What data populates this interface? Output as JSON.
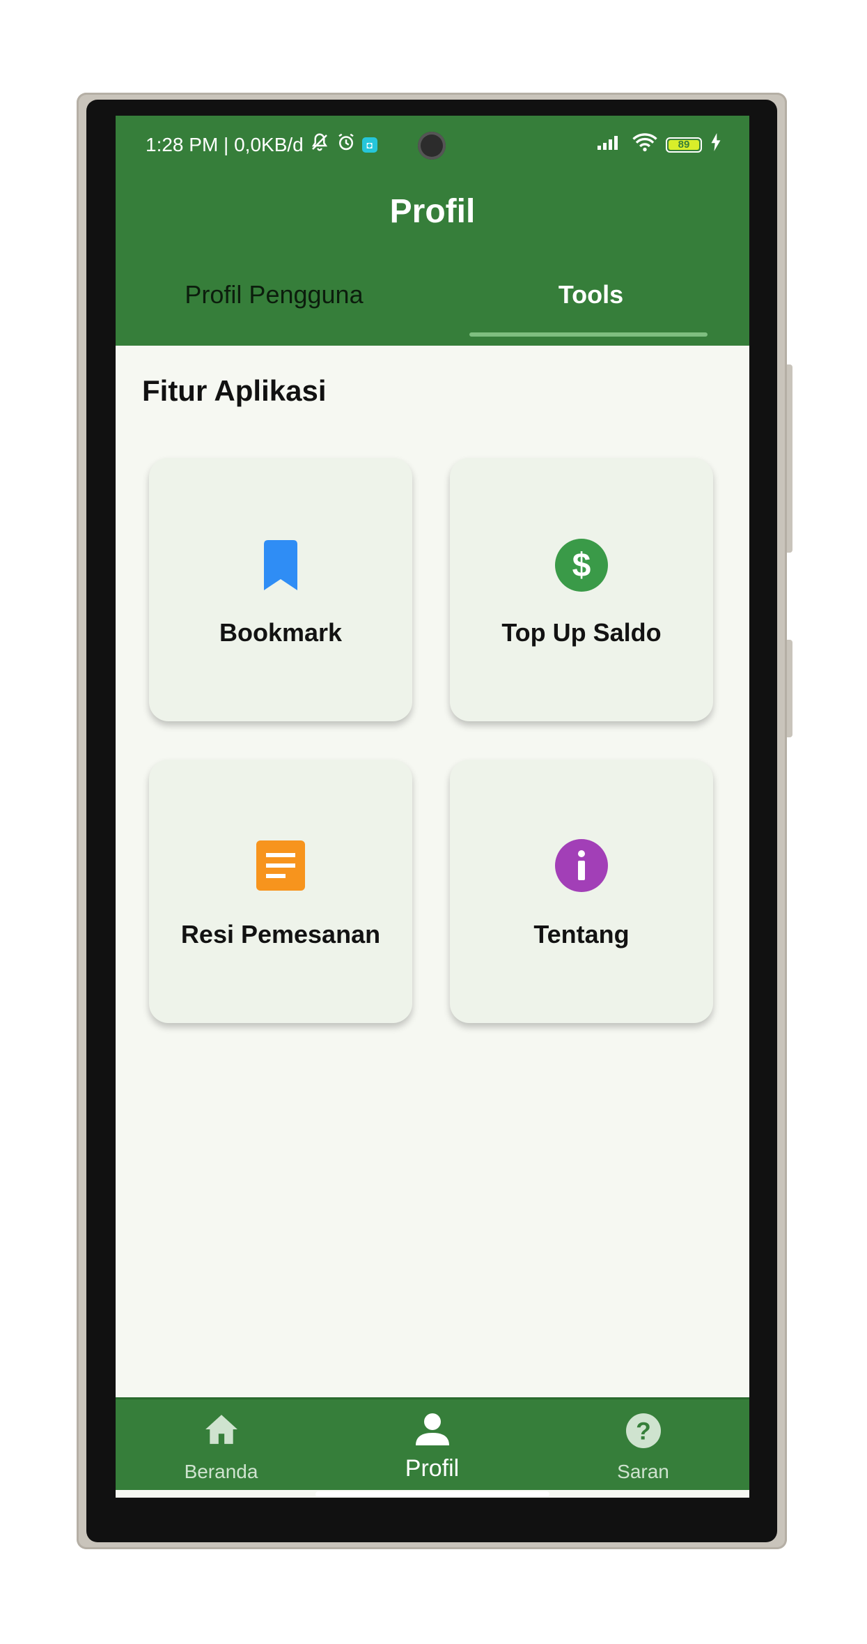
{
  "status_bar": {
    "time_info": "1:28 PM | 0,0KB/d",
    "battery": "89"
  },
  "header": {
    "title": "Profil",
    "tabs": [
      {
        "label": "Profil Pengguna",
        "active": false
      },
      {
        "label": "Tools",
        "active": true
      }
    ]
  },
  "section": {
    "title": "Fitur Aplikasi"
  },
  "features": [
    {
      "label": "Bookmark",
      "icon": "bookmark-icon",
      "color": "#2f8df5"
    },
    {
      "label": "Top Up Saldo",
      "icon": "dollar-icon",
      "color": "#3a9a48"
    },
    {
      "label": "Resi Pemesanan",
      "icon": "receipt-icon",
      "color": "#f7941d"
    },
    {
      "label": "Tentang",
      "icon": "info-icon",
      "color": "#a23fb7"
    }
  ],
  "bottom_nav": [
    {
      "label": "Beranda",
      "icon": "home-icon",
      "active": false
    },
    {
      "label": "Profil",
      "icon": "person-icon",
      "active": true
    },
    {
      "label": "Saran",
      "icon": "help-icon",
      "active": false
    }
  ],
  "colors": {
    "primary": "#367e3a",
    "background": "#f6f8f2",
    "card": "#eef3ea"
  }
}
